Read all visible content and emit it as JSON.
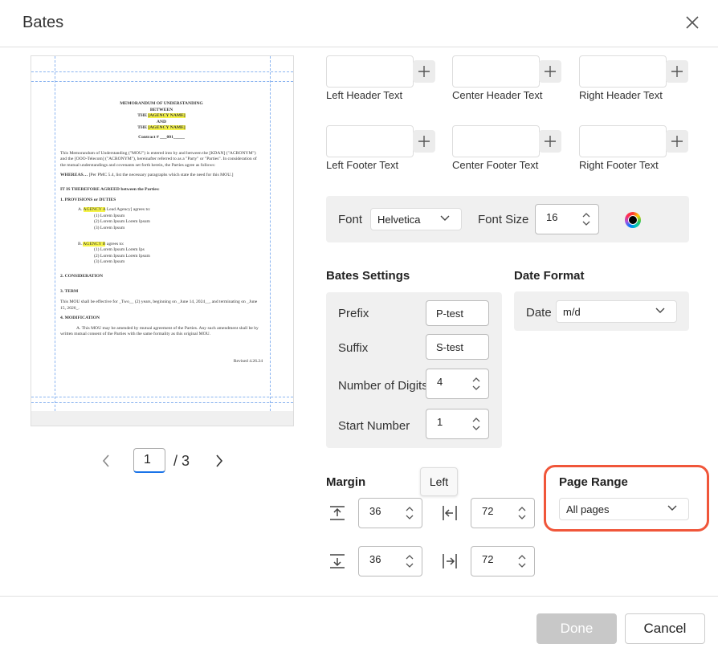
{
  "dialog": {
    "title": "Bates"
  },
  "preview": {
    "doc": {
      "title_line1": "MEMORANDUM OF UNDERSTANDING",
      "title_line2": "BETWEEN",
      "title_line3_pre": "THE ",
      "title_line3_hl": "[AGENCY NAME]",
      "title_line4": "AND",
      "title_line5_pre": "THE ",
      "title_line5_hl": "[AGENCY NAME]",
      "contract": "Contract # ___001_____",
      "intro": "This Memorandum of Understanding (\"MOU\") is entered into by and between the [KDAN] (\"ACRONYM\") and the [OOO-Telecom] (\"ACRONYM\"), hereinafter referred to as a \"Party\" or \"Parties\". In consideration of the mutual understandings and covenants set forth herein, the Parties agree as follows:",
      "whereas_b": "WHEREAS…",
      "whereas": " [Per PMC 5.4, list the necessary paragraphs which state the need for this MOU.]",
      "agreed": "IT IS THEREFORE AGREED between the Parties:",
      "s1": "1.       PROVISIONS or DUTIES",
      "a_pre": "A. ",
      "a_hl": "AGENCY A",
      "a_post": " Lead Agency] agrees to:",
      "a_items": [
        "(1) Lorem Ipsum",
        "(2) Lorem Ipsum Lorem Ipsum",
        "(3) Lorem Ipsum"
      ],
      "b_pre": "B. ",
      "b_hl": "AGENCY B",
      "b_post": " agrees to:",
      "b_items": [
        "(1) Lorem Ipsum Lorem Ips",
        "(2) Lorem Ipsum Lorem Ipsum",
        "(3) Lorem Ipsum"
      ],
      "s2": "2.       CONSIDERATION",
      "s3": "3.       TERM",
      "term": "This MOU shall be effective for _Two__ (2) years, beginning on _June 14, 2024__, and terminating on _June 15, 2026_.",
      "s4": "4.       MODIFICATION",
      "mod": "A. This MOU may be amended by mutual agreement of the Parties. Any such amendment shall be by written mutual consent of the Parties with the same formality as this original MOU.",
      "revised": "Revised 4.26.24"
    }
  },
  "pager": {
    "current": "1",
    "total": "/ 3"
  },
  "text_fields": {
    "left_header": "Left Header Text",
    "center_header": "Center Header Text",
    "right_header": "Right Header Text",
    "left_footer": "Left Footer Text",
    "center_footer": "Center Footer Text",
    "right_footer": "Right Footer Text"
  },
  "font": {
    "label": "Font",
    "value": "Helvetica",
    "size_label": "Font Size",
    "size_value": "16"
  },
  "bates": {
    "title": "Bates Settings",
    "prefix_label": "Prefix",
    "prefix_value": "P-test",
    "suffix_label": "Suffix",
    "suffix_value": "S-test",
    "digits_label": "Number of Digits",
    "digits_value": "4",
    "start_label": "Start Number",
    "start_value": "1"
  },
  "date_format": {
    "title": "Date Format",
    "label": "Date",
    "value": "m/d"
  },
  "margin": {
    "title": "Margin",
    "tooltip": "Left",
    "top": "36",
    "left": "72",
    "bottom": "36",
    "right": "72"
  },
  "page_range": {
    "title": "Page Range",
    "value": "All pages"
  },
  "buttons": {
    "done": "Done",
    "cancel": "Cancel"
  },
  "colors": {
    "accent": "#1a73e8",
    "highlight_ring": "#f0563a",
    "panel_bg": "#f0f0f0",
    "done_disabled": "#c8c8c8"
  }
}
